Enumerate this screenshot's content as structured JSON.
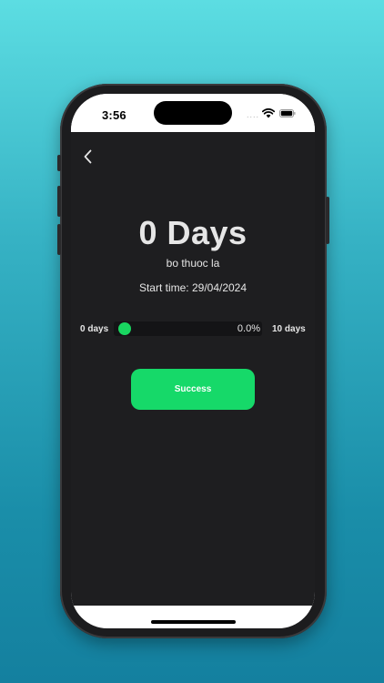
{
  "status_bar": {
    "time": "3:56",
    "signal": "....",
    "wifi_icon": "wifi-icon",
    "battery_icon": "battery-icon"
  },
  "nav": {
    "back_icon": "chevron-left-icon"
  },
  "counter": {
    "title": "0 Days",
    "goal_name": "bo thuoc la",
    "start_time": "Start time: 29/04/2024"
  },
  "progress": {
    "min_label": "0 days",
    "max_label": "10 days",
    "percent_text": "0.0%",
    "fraction": 0.0,
    "fill_color": "#19d660"
  },
  "actions": {
    "success_label": "Success",
    "button_color": "#16d969"
  },
  "colors": {
    "app_background": "#1e1e20",
    "text": "#e6e6e6"
  }
}
